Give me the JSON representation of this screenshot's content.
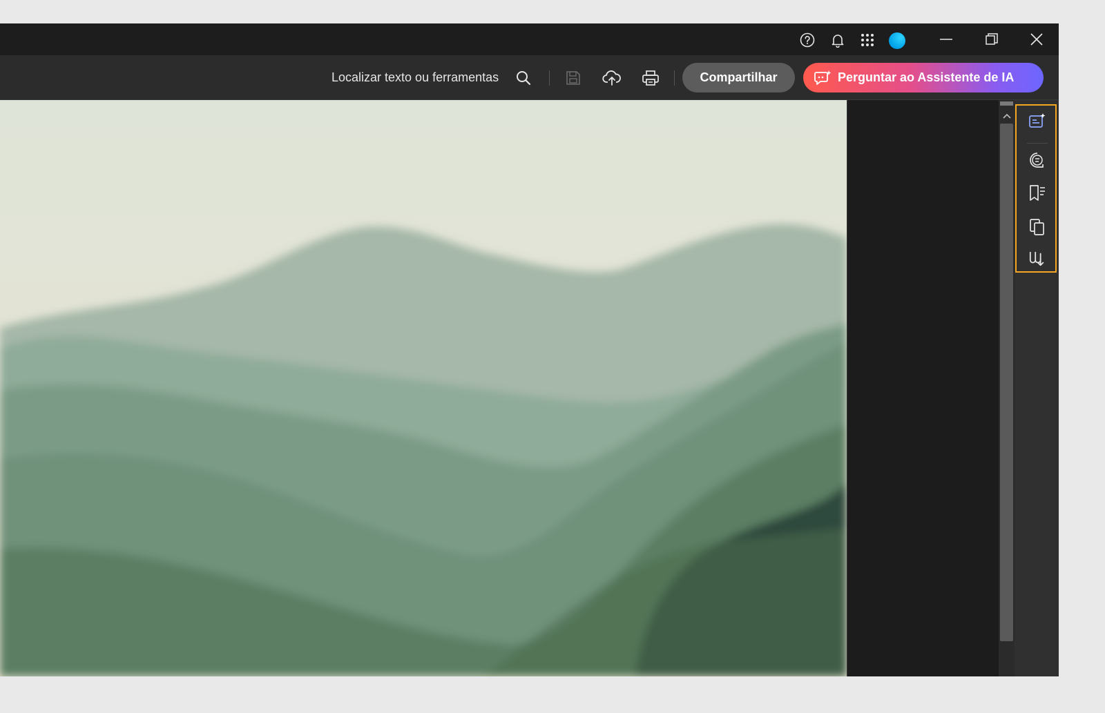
{
  "titlebar": {
    "icons": [
      "help-icon",
      "bell-icon",
      "apps-grid-icon",
      "avatar"
    ],
    "window_controls": [
      "minimize-icon",
      "restore-icon",
      "close-icon"
    ]
  },
  "toolbar": {
    "search_label": "Localizar texto ou ferramentas",
    "share_label": "Compartilhar",
    "ai_label": "Perguntar ao Assistente de IA",
    "icons": [
      "search-icon",
      "save-icon",
      "cloud-upload-icon",
      "print-icon",
      "ai-assistant-icon"
    ]
  },
  "side_panel": {
    "icons": [
      "ai-summary-icon",
      "comment-icon",
      "bookmark-icon",
      "pages-icon",
      "signature-icon"
    ]
  },
  "colors": {
    "accent_highlight": "#f5a623",
    "ai_gradient_start": "#ff5a4e",
    "ai_gradient_end": "#6c66ff",
    "avatar": "#00a0e6"
  }
}
